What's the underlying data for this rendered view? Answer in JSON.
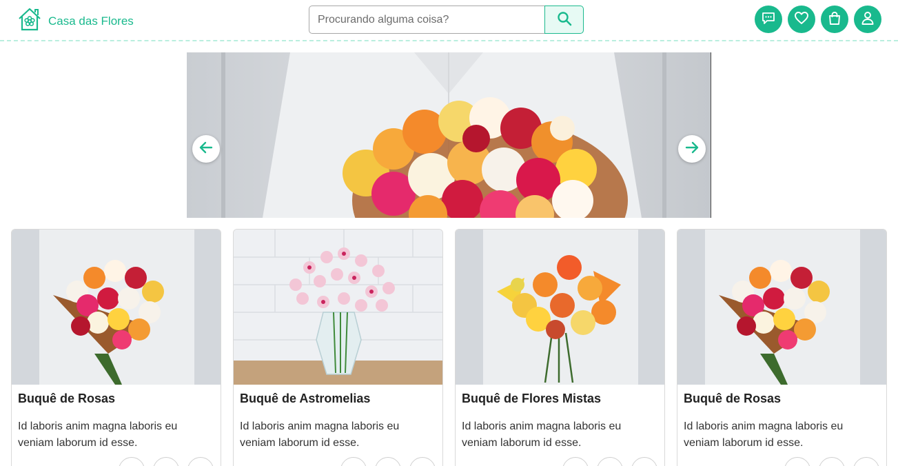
{
  "header": {
    "logo_text": "Casa das Flores",
    "search_placeholder": "Procurando alguma coisa?",
    "icons": [
      "chat-icon",
      "heart-icon",
      "shopping-bag-icon",
      "user-icon"
    ]
  },
  "colors": {
    "accent": "#19b98d",
    "accent_light": "#e7faf4",
    "dashed_border": "#b9eedf"
  },
  "products": [
    {
      "title": "Buquê de Rosas",
      "description": "Id laboris anim magna laboris eu veniam laborum id esse."
    },
    {
      "title": "Buquê de Astromelias",
      "description": "Id laboris anim magna laboris eu veniam laborum id esse."
    },
    {
      "title": "Buquê de Flores Mistas",
      "description": "Id laboris anim magna laboris eu veniam laborum id esse."
    },
    {
      "title": "Buquê de Rosas",
      "description": "Id laboris anim magna laboris eu veniam laborum id esse."
    }
  ]
}
